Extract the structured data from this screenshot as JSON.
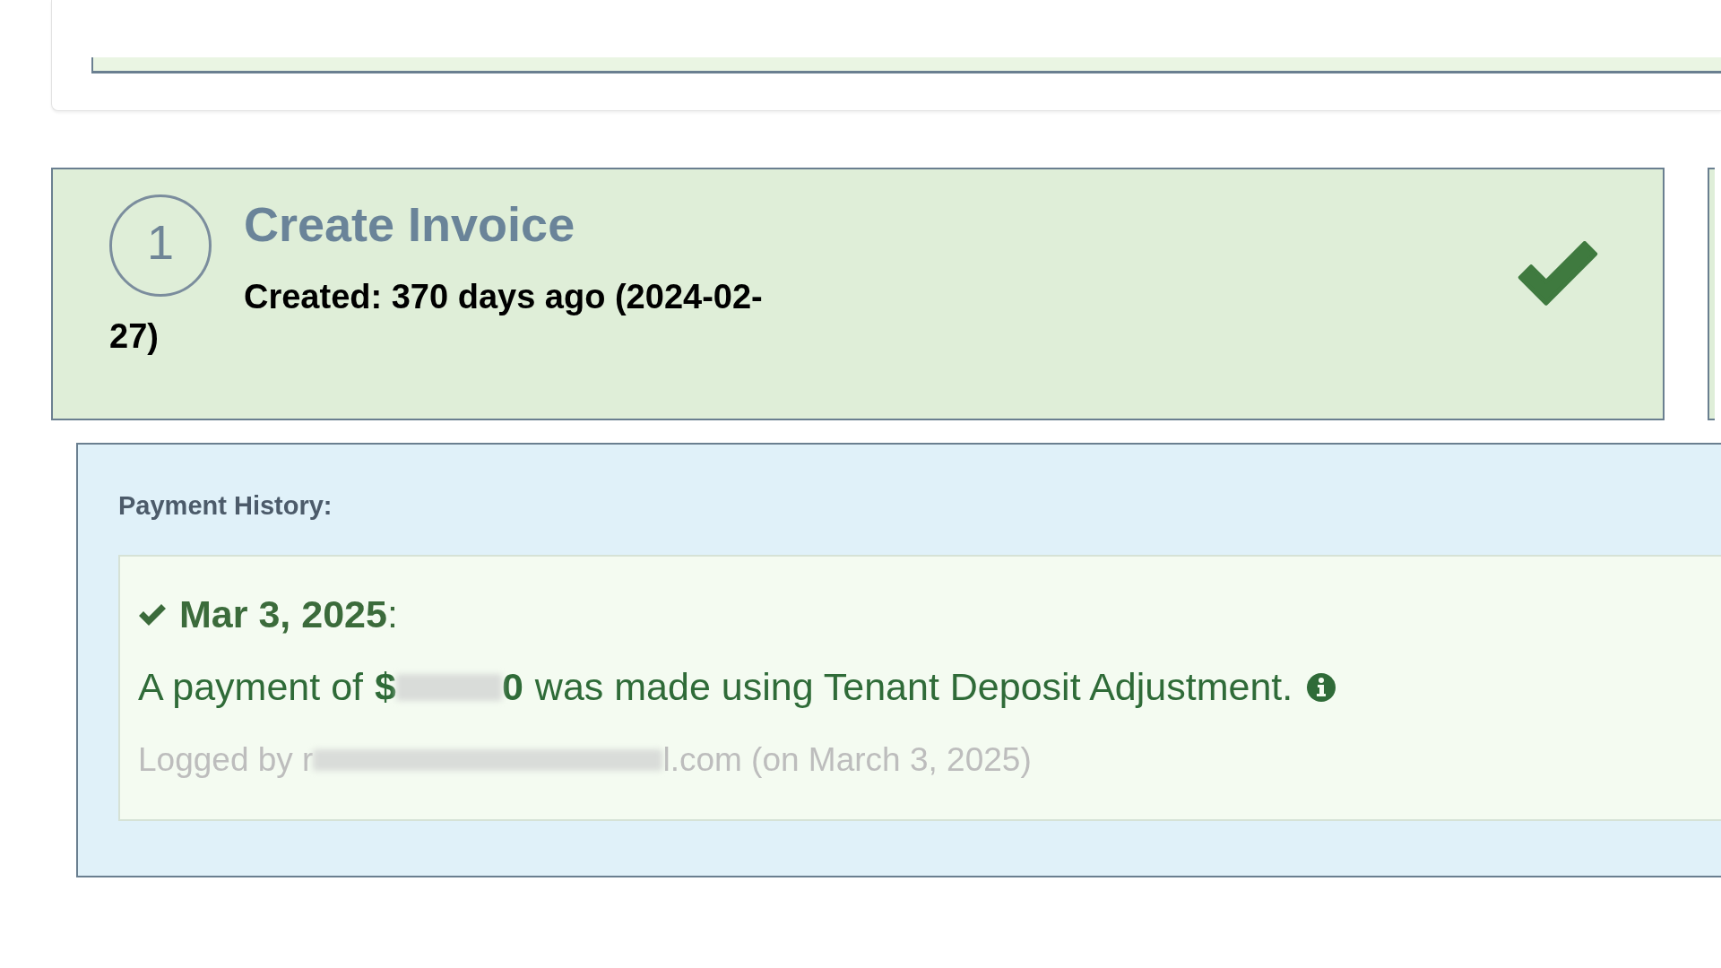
{
  "step": {
    "number": "1",
    "title": "Create Invoice",
    "created": "Created: 370 days ago (2024-02-27)",
    "completed": true
  },
  "payment_history": {
    "heading": "Payment History:",
    "entries": [
      {
        "date": "Mar 3, 2025",
        "date_suffix": ":",
        "text_before": "A payment of",
        "amount_start": "$",
        "amount_end": "0",
        "text_after": "was made using Tenant Deposit Adjustment.",
        "logged_start": "Logged by r",
        "logged_end": "l.com (on March 3, 2025)"
      }
    ]
  }
}
